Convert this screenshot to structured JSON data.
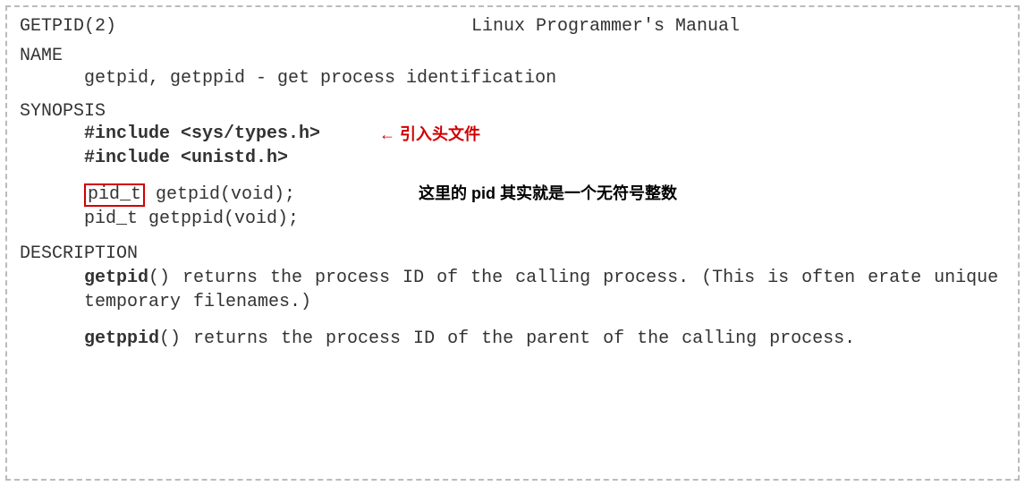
{
  "header": {
    "left": "GETPID(2)",
    "right": "Linux Programmer's Manual"
  },
  "sections": {
    "name_label": "NAME",
    "name_text": "getpid, getppid - get process identification",
    "synopsis_label": "SYNOPSIS",
    "include1": "#include <sys/types.h>",
    "include2": "#include <unistd.h>",
    "proto1_type": "pid_t",
    "proto1_rest": " getpid(void);",
    "proto2": "pid_t getppid(void);",
    "description_label": "DESCRIPTION",
    "getpid_bold": "getpid",
    "getpid_text": "()  returns the process ID of the calling process.  (This is often erate unique temporary filenames.)",
    "getppid_bold": "getppid",
    "getppid_text": "() returns the process ID of the parent of the calling process."
  },
  "annotations": {
    "include_note": "← 引入头文件",
    "pid_note": "这里的 pid 其实就是一个无符号整数"
  }
}
